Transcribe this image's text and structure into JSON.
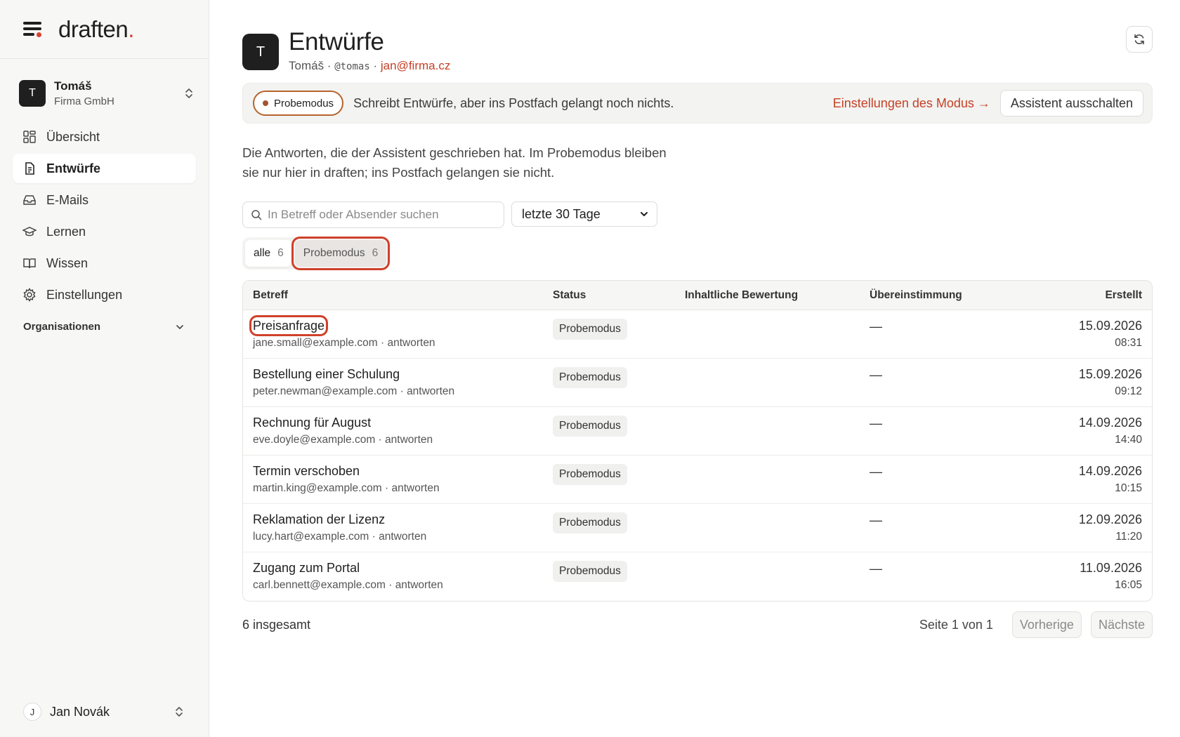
{
  "brand": {
    "name": "draften",
    "dot": "."
  },
  "workspace": {
    "initial": "T",
    "name": "Tomáš",
    "org": "Firma GmbH"
  },
  "nav": [
    {
      "label": "Übersicht",
      "icon": "dashboard-icon"
    },
    {
      "label": "Entwürfe",
      "icon": "document-icon",
      "active": true
    },
    {
      "label": "E-Mails",
      "icon": "inbox-icon"
    },
    {
      "label": "Lernen",
      "icon": "graduation-cap-icon"
    },
    {
      "label": "Wissen",
      "icon": "book-icon"
    },
    {
      "label": "Einstellungen",
      "icon": "gear-icon"
    }
  ],
  "organizations_label": "Organisationen",
  "user": {
    "initial": "J",
    "name": "Jan Novák"
  },
  "header": {
    "initial": "T",
    "title": "Entwürfe",
    "name": "Tomáš",
    "sep1": " · ",
    "handle": "@tomas",
    "sep2": " · ",
    "email": "jan@firma.cz"
  },
  "banner": {
    "mode_label": "Probemodus",
    "text": "Schreibt Entwürfe, aber ins Postfach gelangt noch nichts.",
    "link": "Einstellungen des Modus →",
    "button": "Assistent ausschalten"
  },
  "description": "Die Antworten, die der Assistent geschrieben hat. Im Probemodus bleiben sie nur hier in draften; ins Postfach gelangen sie nicht.",
  "search": {
    "placeholder": "In Betreff oder Absender suchen",
    "value": ""
  },
  "range_select": {
    "selected": "letzte 30 Tage"
  },
  "tabs": [
    {
      "label": "alle",
      "count": "6"
    },
    {
      "label": "Probemodus",
      "count": "6"
    }
  ],
  "table": {
    "columns": [
      "Betreff",
      "Status",
      "Inhaltliche Bewertung",
      "Übereinstimmung",
      "Erstellt"
    ],
    "rows": [
      {
        "subject": "Preisanfrage",
        "sender": "jane.small@example.com",
        "action": "antworten",
        "status": "Probemodus",
        "rating": "",
        "match": "—",
        "date": "15.09.2026",
        "time": "08:31"
      },
      {
        "subject": "Bestellung einer Schulung",
        "sender": "peter.newman@example.com",
        "action": "antworten",
        "status": "Probemodus",
        "rating": "",
        "match": "—",
        "date": "15.09.2026",
        "time": "09:12"
      },
      {
        "subject": "Rechnung für August",
        "sender": "eve.doyle@example.com",
        "action": "antworten",
        "status": "Probemodus",
        "rating": "",
        "match": "—",
        "date": "14.09.2026",
        "time": "14:40"
      },
      {
        "subject": "Termin verschoben",
        "sender": "martin.king@example.com",
        "action": "antworten",
        "status": "Probemodus",
        "rating": "",
        "match": "—",
        "date": "14.09.2026",
        "time": "10:15"
      },
      {
        "subject": "Reklamation der Lizenz",
        "sender": "lucy.hart@example.com",
        "action": "antworten",
        "status": "Probemodus",
        "rating": "",
        "match": "—",
        "date": "12.09.2026",
        "time": "11:20"
      },
      {
        "subject": "Zugang zum Portal",
        "sender": "carl.bennett@example.com",
        "action": "antworten",
        "status": "Probemodus",
        "rating": "",
        "match": "—",
        "date": "11.09.2026",
        "time": "16:05"
      }
    ]
  },
  "footer": {
    "total": "6 insgesamt",
    "page_info": "Seite 1 von 1",
    "prev": "Vorherige",
    "next": "Nächste"
  },
  "colors": {
    "accent": "#c64026",
    "highlight": "#d0402a",
    "sidebar_bg": "#f7f7f6"
  }
}
